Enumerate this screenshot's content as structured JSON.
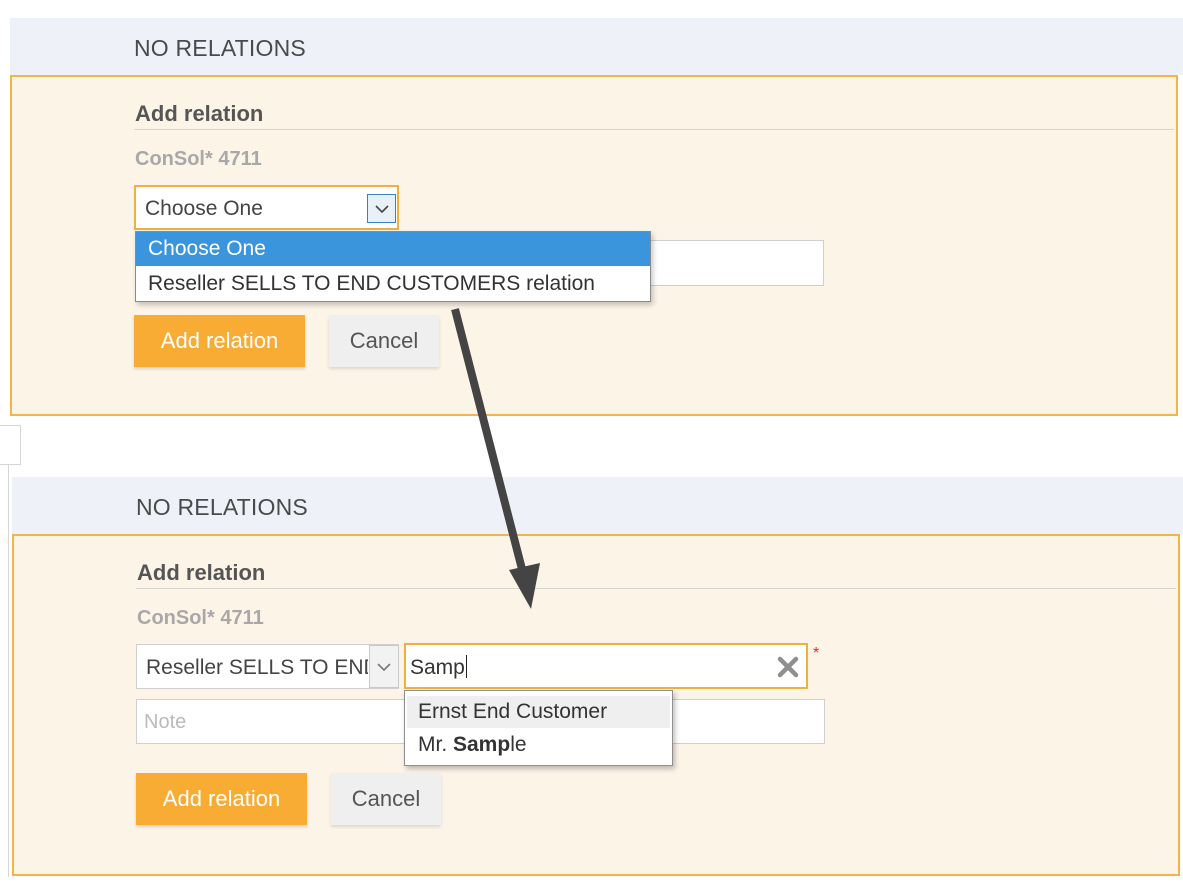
{
  "top": {
    "header": "NO RELATIONS",
    "panel_title": "Add relation",
    "company": "ConSol* 4711",
    "select_value": "Choose One",
    "dropdown_options": [
      "Choose One",
      "Reseller SELLS TO END CUSTOMERS relation"
    ],
    "add_button": "Add relation",
    "cancel_button": "Cancel"
  },
  "bottom": {
    "header": "NO RELATIONS",
    "panel_title": "Add relation",
    "company": "ConSol* 4711",
    "select_value": "Reseller SELLS TO END CUSTOMERS relation",
    "search_value": "Samp",
    "required_marker": "*",
    "note_placeholder": "Note",
    "suggestions": {
      "first": "Ernst End Customer",
      "second_prefix": "Mr. ",
      "second_match": "Samp",
      "second_suffix": "le"
    },
    "add_button": "Add relation",
    "cancel_button": "Cancel"
  },
  "colors": {
    "accent": "#f8ac33",
    "panel_border": "#f5b44a",
    "panel_bg": "#fdf4e8",
    "header_bg": "#eef2f8",
    "selected_option": "#3a95dd",
    "required": "#d9302a"
  }
}
